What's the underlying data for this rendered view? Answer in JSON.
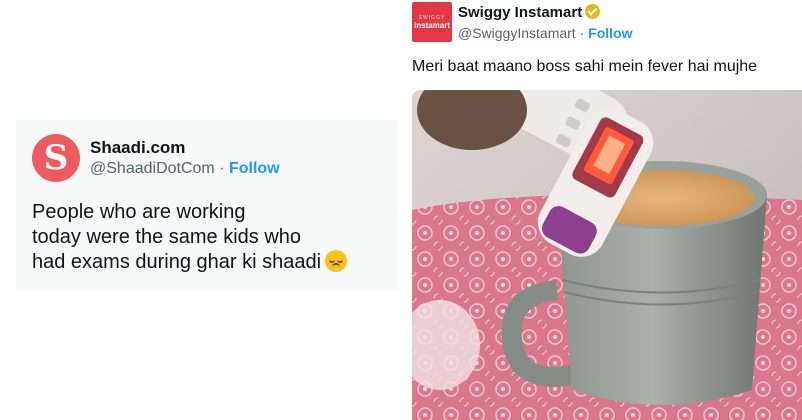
{
  "left_tweet": {
    "avatar_letter": "S",
    "name": "Shaadi.com",
    "handle": "@ShaadiDotCom",
    "separator": " · ",
    "follow_label": "Follow",
    "text_lines": [
      "People who are working",
      "today were the same kids who",
      "had exams during ghar ki shaadi"
    ],
    "emoji": "pensive-face-emoji"
  },
  "right_tweet": {
    "avatar_top": "SWIGGY",
    "avatar_bottom": "instamart",
    "name": "Swiggy Instamart",
    "verified": "gold-verified-badge-icon",
    "handle": "@SwiggyInstamart",
    "separator": " · ",
    "follow_label": "Follow",
    "text": "Meri baat maano boss sahi mein fever hai mujhe",
    "photo": "thermometer in cup of chai on pink patterned tablecloth"
  },
  "colors": {
    "shaadi_red": "#ee5a60",
    "swiggy_orange": "#e23744",
    "follow_blue": "#1d9bf0",
    "muted_gray": "#536471"
  }
}
